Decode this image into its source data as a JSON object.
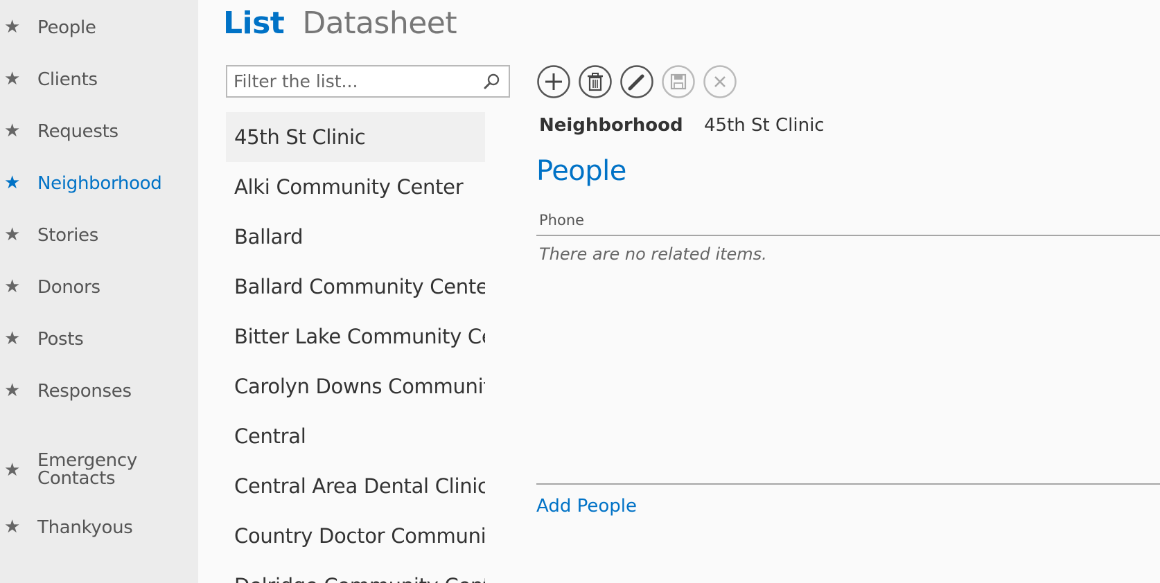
{
  "sidebar": {
    "items": [
      {
        "label": "People",
        "active": false
      },
      {
        "label": "Clients",
        "active": false
      },
      {
        "label": "Requests",
        "active": false
      },
      {
        "label": "Neighborhood",
        "active": true
      },
      {
        "label": "Stories",
        "active": false
      },
      {
        "label": "Donors",
        "active": false
      },
      {
        "label": "Posts",
        "active": false
      },
      {
        "label": "Responses",
        "active": false
      },
      {
        "label": "Emergency",
        "label2": "Contacts",
        "active": false
      },
      {
        "label": "Thankyous",
        "active": false
      }
    ],
    "star_glyph": "★",
    "accent_color": "#0072c6"
  },
  "header": {
    "tab_list": "List",
    "tab_datasheet": "Datasheet"
  },
  "filter": {
    "placeholder": "Filter the list...",
    "value": ""
  },
  "list": {
    "items": [
      "45th St Clinic",
      "Alki Community Center",
      "Ballard",
      "Ballard Community Center",
      "Bitter Lake Community Cen",
      "Carolyn Downs Community",
      "Central",
      "Central Area Dental Clinic",
      "Country Doctor Community",
      "Delridge Community Center"
    ],
    "selected_index": 0
  },
  "toolbar": {
    "buttons": [
      {
        "icon": "add-icon",
        "enabled": true
      },
      {
        "icon": "delete-icon",
        "enabled": true
      },
      {
        "icon": "edit-icon",
        "enabled": true
      },
      {
        "icon": "save-icon",
        "enabled": false
      },
      {
        "icon": "cancel-icon",
        "enabled": false
      }
    ]
  },
  "detail": {
    "field_label": "Neighborhood",
    "field_value": "45th St Clinic",
    "section_title": "People",
    "column_header": "Phone",
    "empty_message": "There are no related items.",
    "add_link": "Add People"
  }
}
